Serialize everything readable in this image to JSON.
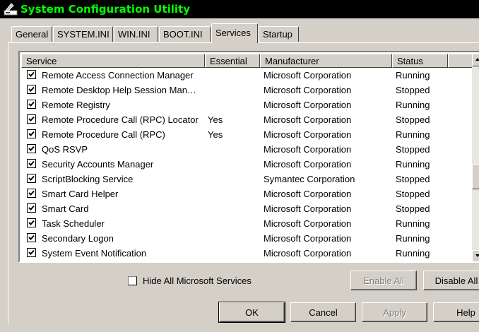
{
  "window": {
    "title": "System Configuration Utility"
  },
  "tabs": [
    "General",
    "SYSTEM.INI",
    "WIN.INI",
    "BOOT.INI",
    "Services",
    "Startup"
  ],
  "active_tab": "Services",
  "columns": {
    "service": "Service",
    "essential": "Essential",
    "manufacturer": "Manufacturer",
    "status": "Status"
  },
  "rows": [
    {
      "checked": true,
      "service": "Remote Access Connection Manager",
      "essential": "",
      "manufacturer": "Microsoft Corporation",
      "status": "Running"
    },
    {
      "checked": true,
      "service": "Remote Desktop Help Session Man…",
      "essential": "",
      "manufacturer": "Microsoft Corporation",
      "status": "Stopped"
    },
    {
      "checked": true,
      "service": "Remote Registry",
      "essential": "",
      "manufacturer": "Microsoft Corporation",
      "status": "Running"
    },
    {
      "checked": true,
      "service": "Remote Procedure Call (RPC) Locator",
      "essential": "Yes",
      "manufacturer": "Microsoft Corporation",
      "status": "Stopped"
    },
    {
      "checked": true,
      "service": "Remote Procedure Call (RPC)",
      "essential": "Yes",
      "manufacturer": "Microsoft Corporation",
      "status": "Running"
    },
    {
      "checked": true,
      "service": "QoS RSVP",
      "essential": "",
      "manufacturer": "Microsoft Corporation",
      "status": "Stopped"
    },
    {
      "checked": true,
      "service": "Security Accounts Manager",
      "essential": "",
      "manufacturer": "Microsoft Corporation",
      "status": "Running"
    },
    {
      "checked": true,
      "service": "ScriptBlocking Service",
      "essential": "",
      "manufacturer": "Symantec Corporation",
      "status": "Stopped"
    },
    {
      "checked": true,
      "service": "Smart Card Helper",
      "essential": "",
      "manufacturer": "Microsoft Corporation",
      "status": "Stopped"
    },
    {
      "checked": true,
      "service": "Smart Card",
      "essential": "",
      "manufacturer": "Microsoft Corporation",
      "status": "Stopped"
    },
    {
      "checked": true,
      "service": "Task Scheduler",
      "essential": "",
      "manufacturer": "Microsoft Corporation",
      "status": "Running"
    },
    {
      "checked": true,
      "service": "Secondary Logon",
      "essential": "",
      "manufacturer": "Microsoft Corporation",
      "status": "Running"
    },
    {
      "checked": true,
      "service": "System Event Notification",
      "essential": "",
      "manufacturer": "Microsoft Corporation",
      "status": "Running"
    }
  ],
  "hide_ms": {
    "label": "Hide All Microsoft Services",
    "checked": false
  },
  "buttons": {
    "enable_all": "Enable All",
    "disable_all": "Disable All",
    "ok": "OK",
    "cancel": "Cancel",
    "apply": "Apply",
    "help": "Help"
  },
  "colors": {
    "title_bg": "#000000",
    "title_fg": "#00ff00",
    "face": "#d4d0c8"
  },
  "icons": {
    "app": "msconfig-icon",
    "check": "check-icon",
    "scroll_up": "arrow-up-icon",
    "scroll_down": "arrow-down-icon"
  }
}
